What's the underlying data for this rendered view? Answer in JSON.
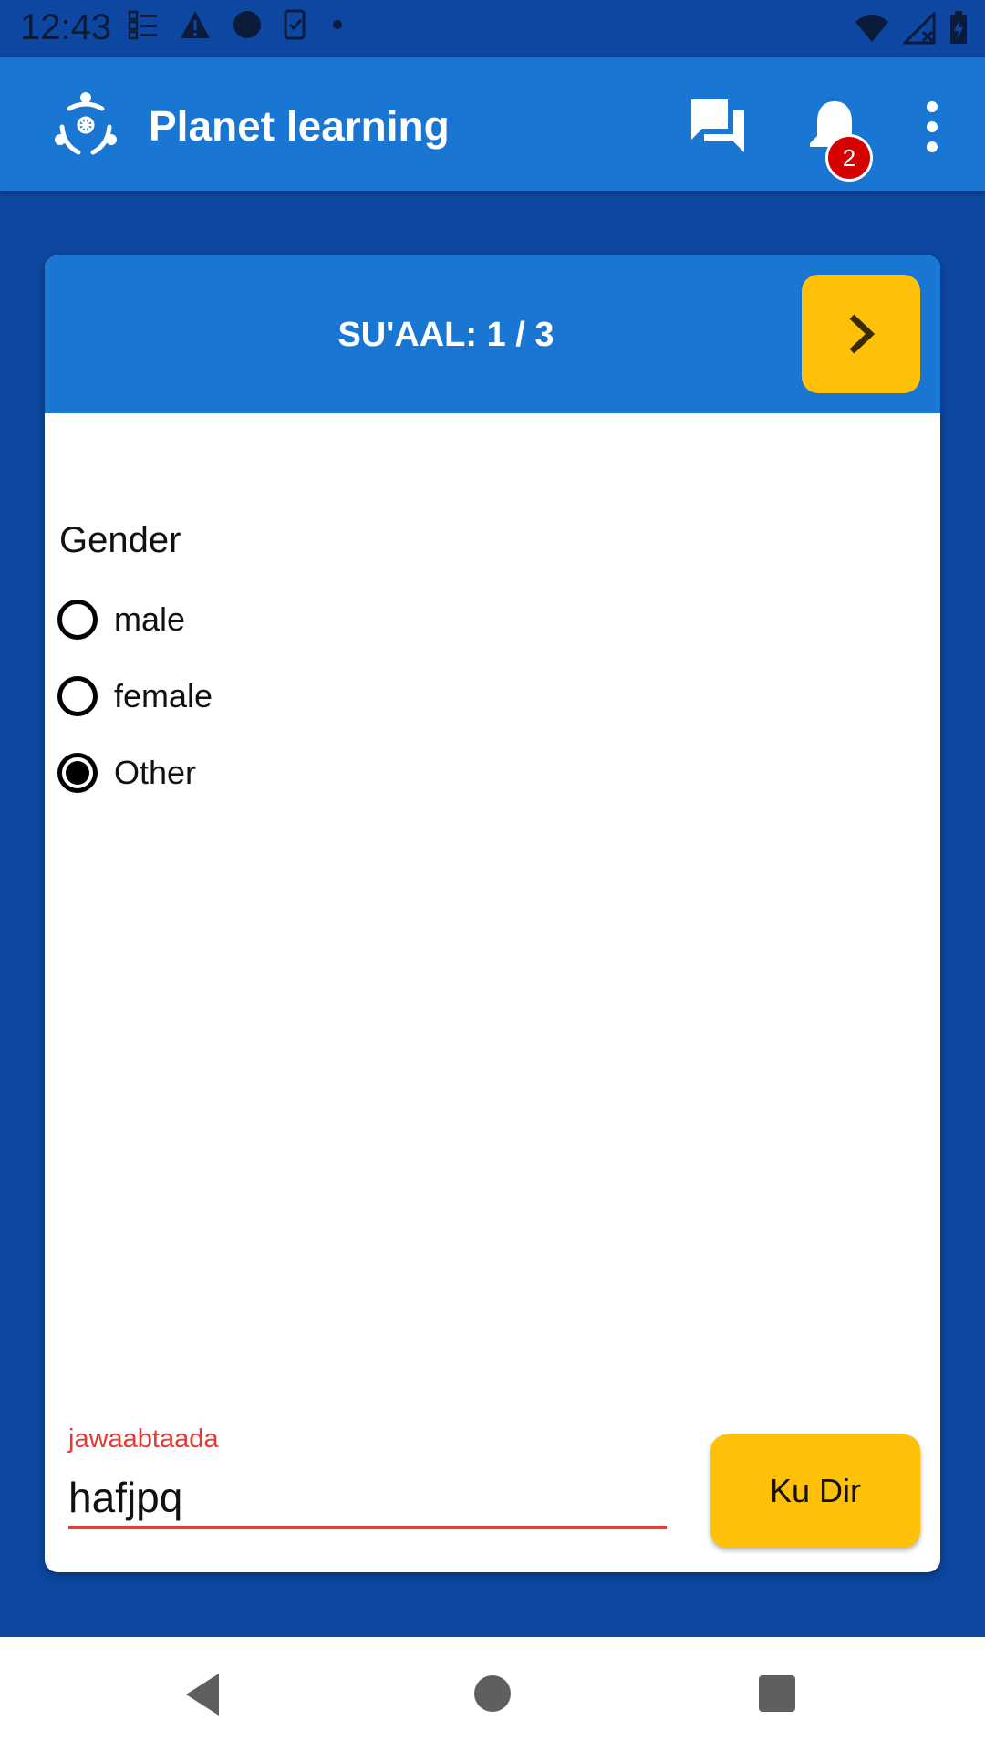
{
  "status_bar": {
    "time": "12:43",
    "left_icons": [
      "checklist-icon",
      "warning-icon",
      "circle-icon",
      "task-icon",
      "dot-icon"
    ],
    "right_icons": [
      "wifi-icon",
      "signal-icon",
      "battery-icon"
    ]
  },
  "app_bar": {
    "title": "Planet learning",
    "notification_count": "2",
    "icons": [
      "logo-icon",
      "chat-icon",
      "bell-icon",
      "more-vert-icon"
    ]
  },
  "card": {
    "header": {
      "counter": "SU'AAL: 1 / 3",
      "next_icon": "chevron-right-icon"
    },
    "question": {
      "label": "Gender",
      "options": [
        {
          "label": "male",
          "checked": false
        },
        {
          "label": "female",
          "checked": false
        },
        {
          "label": "Other",
          "checked": true
        }
      ]
    },
    "answer": {
      "label": "jawaabtaada",
      "value": "hafjpq"
    },
    "submit_label": "Ku Dir"
  },
  "colors": {
    "background": "#0d47a1",
    "app_bar": "#1976d2",
    "accent": "#ffc107",
    "error": "#e53935",
    "badge": "#d50000"
  }
}
